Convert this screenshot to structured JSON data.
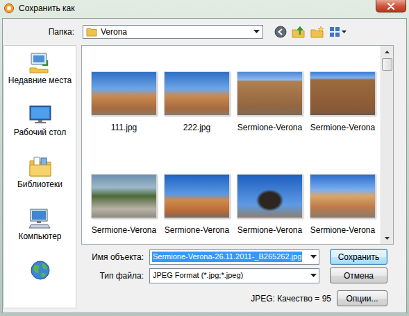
{
  "window": {
    "title": "Сохранить как"
  },
  "folder": {
    "label": "Папка:",
    "value": "Verona"
  },
  "sidebar": {
    "items": [
      {
        "label": "Недавние места",
        "selected": false
      },
      {
        "label": "Рабочий стол",
        "selected": false
      },
      {
        "label": "Библиотеки",
        "selected": false
      },
      {
        "label": "Компьютер",
        "selected": false
      }
    ]
  },
  "files": [
    {
      "name": "111.jpg",
      "selected": false
    },
    {
      "name": "222.jpg",
      "selected": false
    },
    {
      "name": "Sermione-Verona",
      "selected": false
    },
    {
      "name": "Sermione-Verona",
      "selected": false
    },
    {
      "name": "Sermione-Verona",
      "selected": false
    },
    {
      "name": "Sermione-Verona",
      "selected": false
    },
    {
      "name": "Sermione-Verona",
      "selected": false
    },
    {
      "name": "Sermione-Verona",
      "selected": false
    }
  ],
  "scrollbar": {
    "level": 0.07
  },
  "filename": {
    "label": "Имя объекта:",
    "value": "Sermione-Verona-26.11.2011-_B265262.jpg",
    "text_selected": true
  },
  "filetype": {
    "label": "Тип файла:",
    "value": "JPEG Format (*.jpg;*.jpeg)"
  },
  "quality": "JPEG: Качество = 95",
  "buttons": [
    {
      "label": "Сохранить",
      "default": true
    },
    {
      "label": "Отмена",
      "default": false
    },
    {
      "label": "Опции...",
      "default": false
    }
  ]
}
